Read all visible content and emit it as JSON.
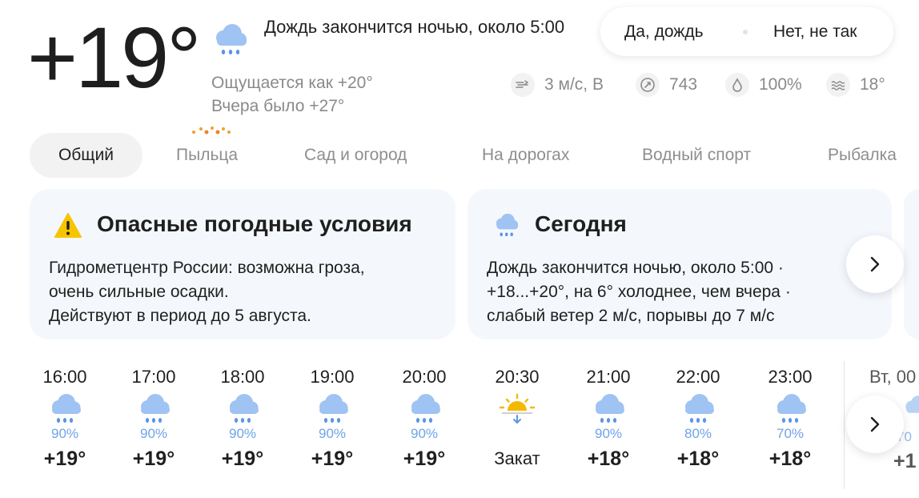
{
  "current": {
    "temperature": "+19°",
    "condition": "Дождь закончится ночью, около 5:00",
    "feels_like": "Ощущается как +20°",
    "yesterday": "Вчера было +27°",
    "icon": "rain-cloud-icon"
  },
  "feedback": {
    "yes_label": "Да, дождь",
    "no_label": "Нет, не так"
  },
  "stats": {
    "wind": "3 м/с, В",
    "pressure": "743",
    "humidity": "100%",
    "water_temp": "18°"
  },
  "tabs": [
    {
      "label": "Общий",
      "active": true
    },
    {
      "label": "Пыльца"
    },
    {
      "label": "Сад и огород"
    },
    {
      "label": "На дорогах"
    },
    {
      "label": "Водный спорт"
    },
    {
      "label": "Рыбалка"
    }
  ],
  "cards": [
    {
      "title": "Опасные погодные условия",
      "icon": "warning-icon",
      "lines": [
        "Гидрометцентр России: возможна гроза,",
        "очень сильные осадки.",
        "Действуют в период до 5 августа."
      ]
    },
    {
      "title": "Сегодня",
      "icon": "rain-cloud-icon",
      "lines": [
        "Дождь закончится ночью, около 5:00 ·",
        "+18...+20°, на 6° холоднее, чем вчера ·",
        "слабый ветер 2 м/с, порывы до 7 м/с"
      ]
    }
  ],
  "hourly": [
    {
      "time": "16:00",
      "prob": "90%",
      "temp": "+19°",
      "icon": "rain-cloud-icon"
    },
    {
      "time": "17:00",
      "prob": "90%",
      "temp": "+19°",
      "icon": "rain-cloud-icon"
    },
    {
      "time": "18:00",
      "prob": "90%",
      "temp": "+19°",
      "icon": "rain-cloud-icon"
    },
    {
      "time": "19:00",
      "prob": "90%",
      "temp": "+19°",
      "icon": "rain-cloud-icon"
    },
    {
      "time": "20:00",
      "prob": "90%",
      "temp": "+19°",
      "icon": "rain-cloud-icon"
    },
    {
      "time": "20:30",
      "label": "Закат",
      "icon": "sunset-icon"
    },
    {
      "time": "21:00",
      "prob": "90%",
      "temp": "+18°",
      "icon": "rain-cloud-icon"
    },
    {
      "time": "22:00",
      "prob": "80%",
      "temp": "+18°",
      "icon": "rain-cloud-icon"
    },
    {
      "time": "23:00",
      "prob": "70%",
      "temp": "+18°",
      "icon": "rain-cloud-icon"
    }
  ],
  "hourly_next_day": {
    "time": "Вт, 00",
    "prob": "70",
    "temp": "+1"
  },
  "colors": {
    "accent_blue": "#6fa3e8",
    "card_bg": "#f4f8fd",
    "sun": "#f5b800",
    "warning": "#f7c500"
  }
}
